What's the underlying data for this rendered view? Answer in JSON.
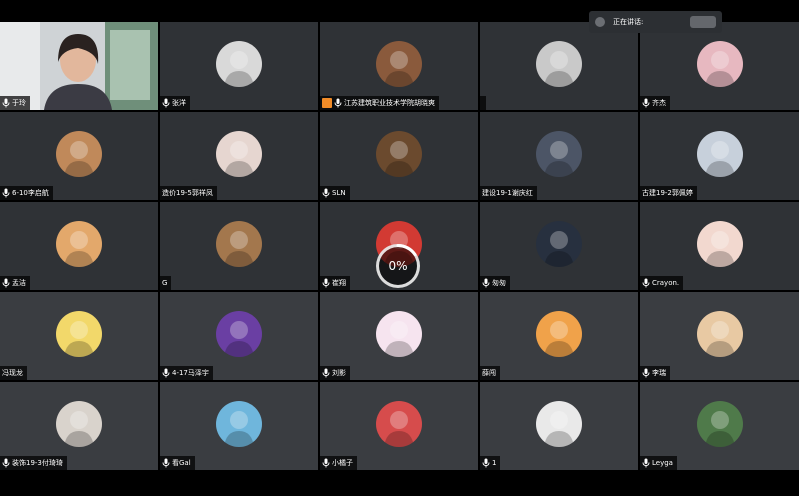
{
  "speaking_indicator": {
    "label": "正在讲话:"
  },
  "loading": {
    "percent_label": "0%"
  },
  "colors": {
    "tile_bg": "#2f3236",
    "name_bar": "#000000",
    "host_badge": "#f28c28"
  },
  "participants": [
    {
      "name": "于玲",
      "type": "video",
      "icon": "mic-icon"
    },
    {
      "name": "张洋",
      "type": "avatar",
      "icon": "mic-icon",
      "avatar_color": "#d9d9d9"
    },
    {
      "name": "江苏建筑职业技术学院胡晓爽",
      "type": "avatar",
      "icon": "mic-icon",
      "host": true,
      "avatar_color": "#8a5a3c"
    },
    {
      "name": "",
      "type": "avatar",
      "avatar_color": "#c9c9c9"
    },
    {
      "name": "齐杰",
      "type": "avatar",
      "icon": "mic-icon",
      "avatar_color": "#e7b8c0"
    },
    {
      "name": "6-10李启航",
      "type": "avatar",
      "icon": "mic-icon",
      "avatar_color": "#c0895a"
    },
    {
      "name": "造价19-5郭祥凤",
      "type": "avatar",
      "avatar_color": "#e6d6d0"
    },
    {
      "name": "SLN",
      "type": "avatar",
      "icon": "mic-icon",
      "avatar_color": "#6b4a2e"
    },
    {
      "name": "建设19-1谢庆红",
      "type": "avatar",
      "avatar_color": "#4c5566"
    },
    {
      "name": "古建19-2郭佩婷",
      "type": "avatar",
      "avatar_color": "#c7d0db"
    },
    {
      "name": "孟洁",
      "type": "avatar",
      "icon": "mic-icon",
      "avatar_color": "#e3a86b"
    },
    {
      "name": "G",
      "type": "avatar",
      "avatar_color": "#a3774d"
    },
    {
      "name": "崔翔",
      "type": "avatar",
      "icon": "mic-icon",
      "avatar_color": "#d23a33"
    },
    {
      "name": "匆匆",
      "type": "avatar",
      "icon": "mic-icon",
      "avatar_color": "#27303f"
    },
    {
      "name": "Crayon.",
      "type": "avatar",
      "icon": "mic-icon",
      "avatar_color": "#f2d8cf"
    },
    {
      "name": "冯现龙",
      "type": "avatar",
      "avatar_color": "#f2d86a"
    },
    {
      "name": "4-17马泽宇",
      "type": "avatar",
      "icon": "mic-icon",
      "avatar_color": "#6a3fa3"
    },
    {
      "name": "刘影",
      "type": "avatar",
      "icon": "mic-icon",
      "avatar_color": "#f6e4ef"
    },
    {
      "name": "薛闯",
      "type": "avatar",
      "avatar_color": "#f0a24a"
    },
    {
      "name": "李瑞",
      "type": "avatar",
      "icon": "mic-icon",
      "avatar_color": "#e8c9a3"
    },
    {
      "name": "装饰19-3付琦琦",
      "type": "avatar",
      "icon": "mic-icon",
      "avatar_color": "#d9d3cc"
    },
    {
      "name": "看Gal",
      "type": "avatar",
      "icon": "mic-icon",
      "avatar_color": "#6fb6dc"
    },
    {
      "name": "小橘子",
      "type": "avatar",
      "icon": "mic-icon",
      "avatar_color": "#d64c4c"
    },
    {
      "name": "1",
      "type": "avatar",
      "icon": "mic-icon",
      "avatar_color": "#e9e9e9"
    },
    {
      "name": "Leyga",
      "type": "avatar",
      "icon": "mic-icon",
      "avatar_color": "#4f7a4a"
    }
  ]
}
